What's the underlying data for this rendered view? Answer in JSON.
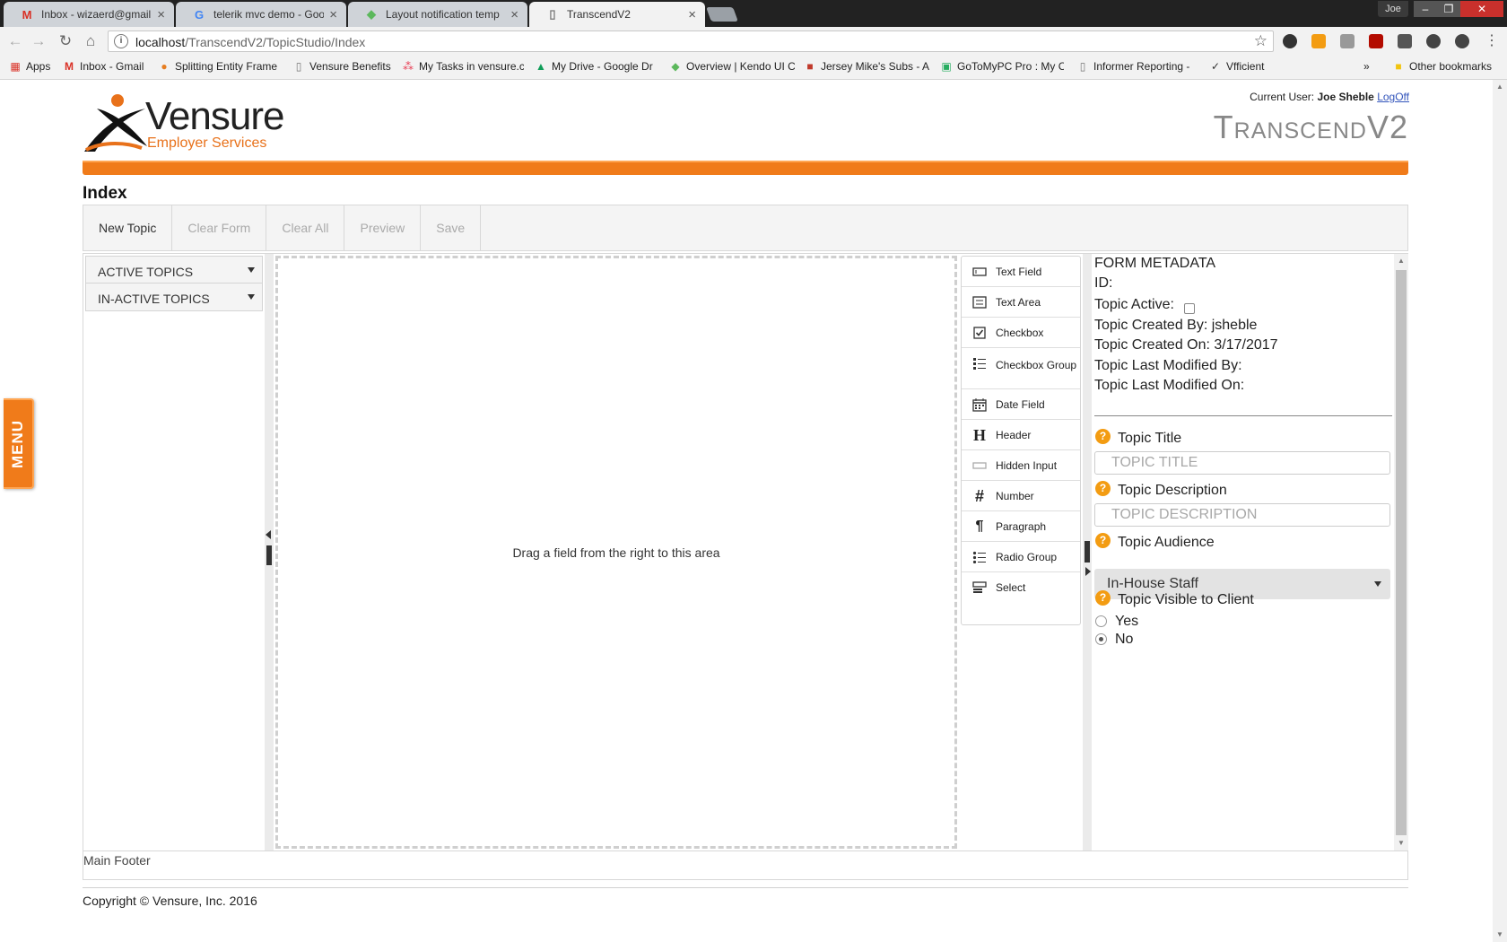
{
  "browser": {
    "tabs": [
      {
        "label": "Inbox - wizaerd@gmail.c",
        "icon": "gmail-icon"
      },
      {
        "label": "telerik mvc demo - Goog",
        "icon": "google-icon"
      },
      {
        "label": "Layout notification temp",
        "icon": "kendo-icon"
      },
      {
        "label": "TranscendV2",
        "icon": "page-icon"
      }
    ],
    "user_badge": "Joe",
    "address": {
      "host": "localhost",
      "path": "/TranscendV2/TopicStudio/Index"
    },
    "bookmarks": [
      {
        "label": "Apps",
        "icon": "apps-grid-icon"
      },
      {
        "label": "Inbox - Gmail",
        "icon": "gmail-icon"
      },
      {
        "label": "Splitting Entity Frame",
        "icon": "site-icon"
      },
      {
        "label": "Vensure Benefits",
        "icon": "page-icon"
      },
      {
        "label": "My Tasks in vensure.c",
        "icon": "asana-icon"
      },
      {
        "label": "My Drive - Google Dr",
        "icon": "google-drive-icon"
      },
      {
        "label": "Overview | Kendo UI C",
        "icon": "kendo-icon"
      },
      {
        "label": "Jersey Mike's Subs - A",
        "icon": "jersey-mikes-icon"
      },
      {
        "label": "GoToMyPC Pro : My C",
        "icon": "gotomypc-icon"
      },
      {
        "label": "Informer Reporting -",
        "icon": "page-icon"
      },
      {
        "label": "Vfficient",
        "icon": "vfficient-icon"
      }
    ],
    "more_bookmarks": "»",
    "other_bookmarks": "Other bookmarks"
  },
  "header": {
    "logo_word": "Vensure",
    "logo_sub": "Employer Services",
    "current_user_label": "Current User:",
    "current_user": "Joe Sheble",
    "logoff": "LogOff",
    "brand": "TranscendV2"
  },
  "page_title": "Index",
  "toolbar": {
    "new_topic": "New Topic",
    "clear_form": "Clear Form",
    "clear_all": "Clear All",
    "preview": "Preview",
    "save": "Save"
  },
  "topics": {
    "active": "ACTIVE TOPICS",
    "inactive": "IN-ACTIVE TOPICS"
  },
  "dropzone_text": "Drag a field from the right to this area",
  "palette": [
    {
      "label": "Text Field",
      "icon": "text-field-icon"
    },
    {
      "label": "Text Area",
      "icon": "text-area-icon"
    },
    {
      "label": "Checkbox",
      "icon": "checkbox-icon"
    },
    {
      "label": "Checkbox Group",
      "icon": "checkbox-group-icon"
    },
    {
      "label": "Date Field",
      "icon": "calendar-icon"
    },
    {
      "label": "Header",
      "icon": "header-icon"
    },
    {
      "label": "Hidden Input",
      "icon": "hidden-input-icon"
    },
    {
      "label": "Number",
      "icon": "number-icon"
    },
    {
      "label": "Paragraph",
      "icon": "paragraph-icon"
    },
    {
      "label": "Radio Group",
      "icon": "radio-group-icon"
    },
    {
      "label": "Select",
      "icon": "select-icon"
    }
  ],
  "metadata": {
    "heading": "FORM METADATA",
    "id_label": "ID:",
    "active_label": "Topic Active:",
    "created_by": "Topic Created By: jsheble",
    "created_on": "Topic Created On: 3/17/2017",
    "modified_by": "Topic Last Modified By:",
    "modified_on": "Topic Last Modified On:",
    "title_label": "Topic Title",
    "title_placeholder": "TOPIC TITLE",
    "description_label": "Topic Description",
    "description_placeholder": "TOPIC DESCRIPTION",
    "audience_label": "Topic Audience",
    "audience_value": "In-House Staff",
    "visible_label": "Topic Visible to Client",
    "yes": "Yes",
    "no": "No",
    "visible_selected": "No"
  },
  "footer": "Main Footer",
  "copyright": "Copyright © Vensure, Inc. 2016",
  "side_menu": "MENU",
  "colors": {
    "accent": "#f07b1a",
    "help": "#f39c12"
  }
}
